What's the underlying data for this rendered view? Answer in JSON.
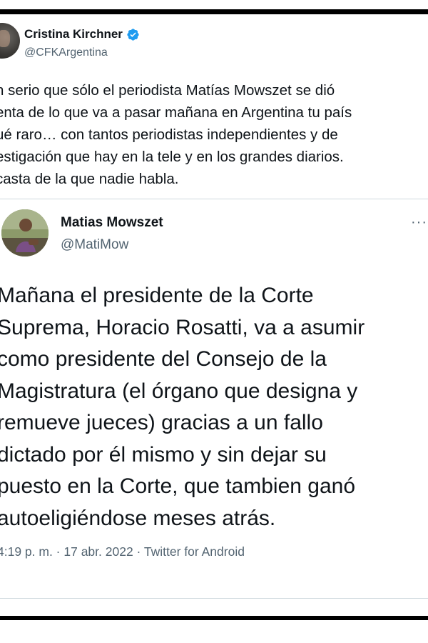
{
  "outer_tweet": {
    "author_name": "Cristina Kirchner",
    "verified_icon": "verified-badge-icon",
    "handle": "@CFKArgentina",
    "text_lines": [
      "n serio que sólo el periodista Matías Mowszet se dió",
      "enta de lo que va a pasar mañana en Argentina tu país",
      "ué raro… con tantos periodistas independientes y de",
      "estigación que hay en la tele y en los grandes diarios.",
      "casta de la que nadie habla."
    ]
  },
  "quoted_tweet": {
    "author_name": "Matias Mowszet",
    "handle": "@MatiMow",
    "more_icon": "more-options-icon",
    "text_lines": [
      "Mañana el presidente de la Corte",
      "Suprema, Horacio Rosatti, va a asumir",
      "como presidente del Consejo de la",
      "Magistratura (el órgano que designa y",
      "remueve jueces) gracias a un fallo",
      "dictado por él mismo y sin dejar su",
      "puesto en la Corte, que tambien ganó",
      "autoeligiéndose meses atrás."
    ],
    "meta": "4:19 p. m. · 17 abr. 2022 · Twitter for Android"
  },
  "colors": {
    "text_primary": "#0f1419",
    "text_secondary": "#536471",
    "verified_blue": "#1d9bf0",
    "border": "#cfd9de"
  }
}
